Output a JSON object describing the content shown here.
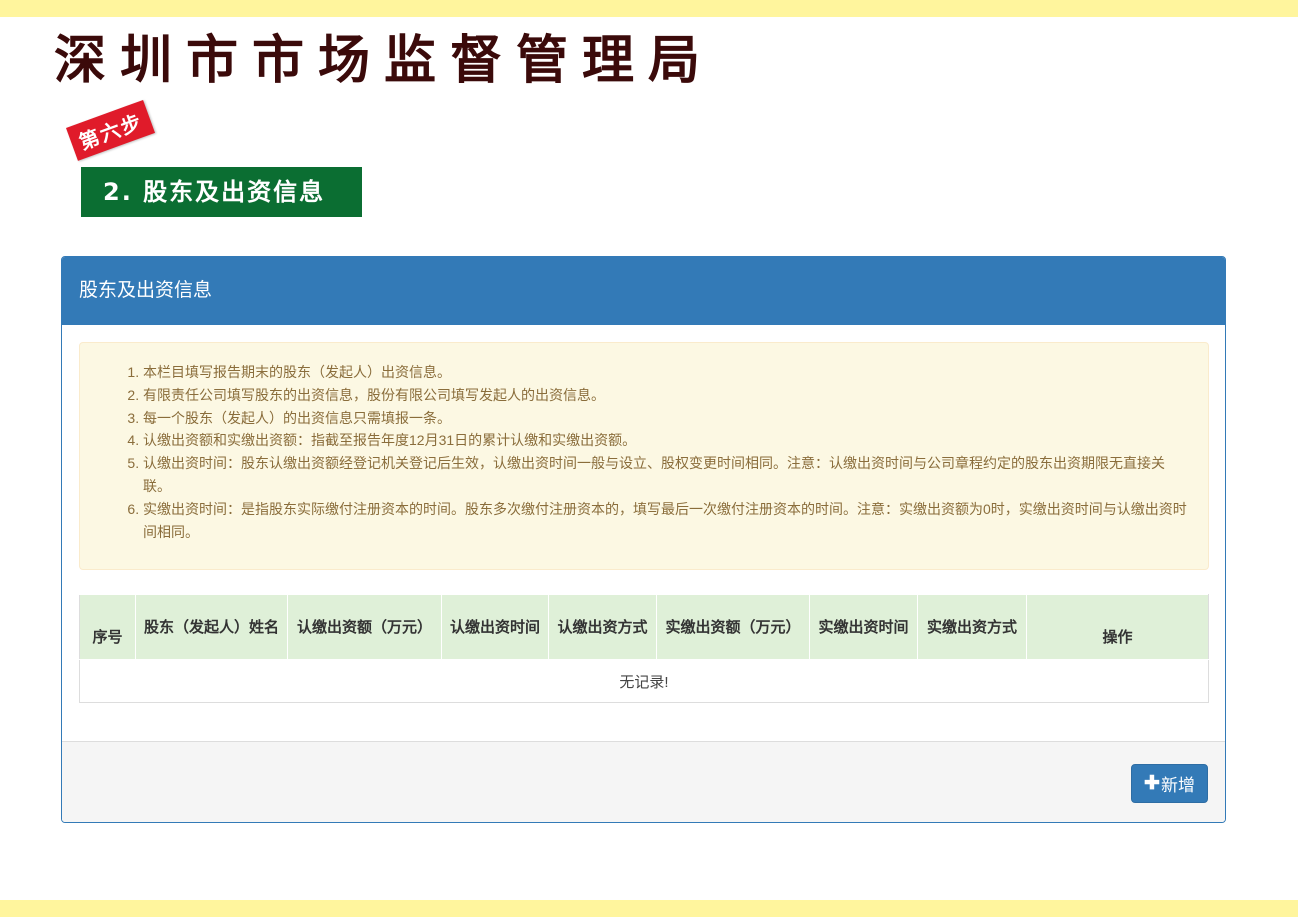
{
  "header": {
    "org_title": "深圳市市场监督管理局",
    "step_label": "第六步",
    "section_title": "2. 股东及出资信息"
  },
  "panel": {
    "title": "股东及出资信息",
    "notes": [
      "本栏目填写报告期末的股东（发起人）出资信息。",
      "有限责任公司填写股东的出资信息，股份有限公司填写发起人的出资信息。",
      "每一个股东（发起人）的出资信息只需填报一条。",
      "认缴出资额和实缴出资额：指截至报告年度12月31日的累计认缴和实缴出资额。",
      "认缴出资时间：股东认缴出资额经登记机关登记后生效，认缴出资时间一般与设立、股权变更时间相同。注意：认缴出资时间与公司章程约定的股东出资期限无直接关联。",
      "实缴出资时间：是指股东实际缴付注册资本的时间。股东多次缴付注册资本的，填写最后一次缴付注册资本的时间。注意：实缴出资额为0时，实缴出资时间与认缴出资时间相同。"
    ],
    "table": {
      "columns": [
        "序号",
        "股东（发起人）姓名",
        "认缴出资额（万元）",
        "认缴出资时间",
        "认缴出资方式",
        "实缴出资额（万元）",
        "实缴出资时间",
        "实缴出资方式",
        "操作"
      ],
      "empty_text": "无记录!"
    },
    "add_button_label": "新增",
    "add_button_icon": "plus-icon"
  },
  "colors": {
    "band": "#fff59d",
    "primary": "#337ab7",
    "banner_green": "#0b6e32",
    "step_red": "#e01b2a",
    "header_row": "#dff0d8",
    "notice_bg": "#fcf8e3",
    "notice_text": "#8a6d3b"
  }
}
